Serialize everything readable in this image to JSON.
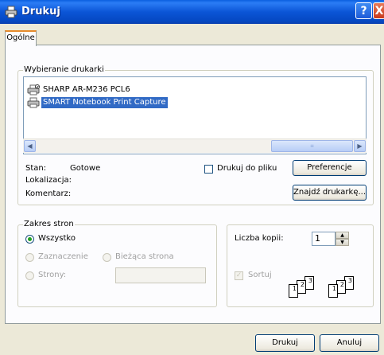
{
  "window": {
    "title": "Drukuj",
    "help_label": "?",
    "close_label": "X"
  },
  "tabs": [
    {
      "label": "Ogólne"
    }
  ],
  "printer_group": {
    "legend": "Wybieranie drukarki",
    "printers": [
      {
        "label": "SHARP AR-M236 PCL6",
        "icon": "printer-icon",
        "selected": false
      },
      {
        "label": "SMART Notebook Print Capture",
        "icon": "printer-icon",
        "selected": true
      }
    ],
    "status_label": "Stan:",
    "status_value": "Gotowe",
    "location_label": "Lokalizacja:",
    "comment_label": "Komentarz:",
    "print_to_file_label": "Drukuj do pliku",
    "preferences_button": "Preferencje",
    "find_printer_button": "Znajdź drukarkę..."
  },
  "page_range": {
    "legend": "Zakres stron",
    "all_label": "Wszystko",
    "selection_label": "Zaznaczenie",
    "current_page_label": "Bieżąca strona",
    "pages_label": "Strony:",
    "pages_value": ""
  },
  "copies": {
    "count_label": "Liczba kopii:",
    "count_value": "1",
    "collate_label": "Sortuj",
    "page_numbers": [
      "1",
      "2",
      "3"
    ]
  },
  "footer": {
    "print_button": "Drukuj",
    "cancel_button": "Anuluj"
  }
}
